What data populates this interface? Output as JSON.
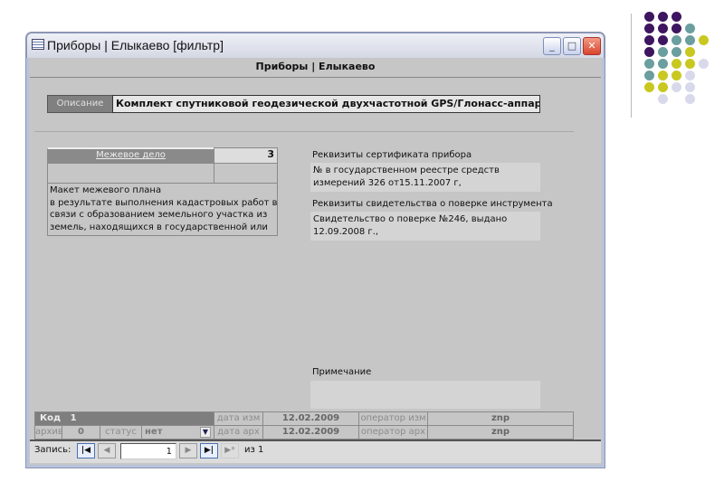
{
  "window": {
    "title": "Приборы | Елыкаево [фильтр]",
    "header": "Приборы | Елыкаево",
    "icon": "form-icon",
    "controls": [
      "minimize-icon",
      "maximize-icon",
      "close-icon"
    ]
  },
  "description": {
    "label": "Описание",
    "value": "Комплект спутниковой геодезической двухчастотной GPS/Глонасс-аппаратуры «"
  },
  "subform": {
    "link": "Межевое дело",
    "count": "3",
    "memo_lines": [
      "Макет межевого плана",
      "в результате выполнения кадастровых работ в",
      "связи с образованием земельного участка из",
      "земель, находящихся в государственной или"
    ]
  },
  "certificate": {
    "label": "Реквизиты сертификата прибора",
    "lines": [
      "№ в государственном реестре средств",
      "измерений  326  от15.11.2007 г,"
    ]
  },
  "verification": {
    "label": "Реквизиты свидетельства о поверке инструмента",
    "lines": [
      "Свидетельство о поверке №246, выдано",
      "12.09.2008 г.,"
    ]
  },
  "note": {
    "label": "Примечание",
    "value": ""
  },
  "footer": {
    "code_label": "Код",
    "code_value": "1",
    "date_mod_label": "дата изм",
    "date_mod": "12.02.2009",
    "operator_mod_label": "оператор изм",
    "operator_mod": "znp",
    "archive_label": "архив",
    "archive_value": "0",
    "status_label": "статус",
    "status_value": "нет",
    "date_arch_label": "дата арх",
    "date_arch": "12.02.2009",
    "operator_arch_label": "оператор арх",
    "operator_arch": "znp"
  },
  "navigator": {
    "label": "Запись:",
    "current": "1",
    "of_label": "из 1"
  },
  "colors": {
    "purple": "#3e1560",
    "teal": "#6b9e9e",
    "yellow": "#c9c820",
    "lavender": "#d9d9ec"
  }
}
